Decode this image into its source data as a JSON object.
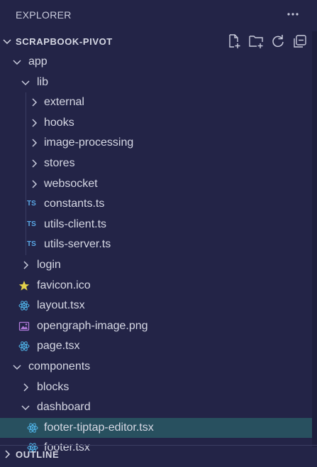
{
  "explorer": {
    "title": "EXPLORER",
    "more_icon": "ellipsis-icon"
  },
  "workspace": {
    "name": "SCRAPBOOK-PIVOT",
    "toolbar": [
      "new-file-icon",
      "new-folder-icon",
      "refresh-icon",
      "collapse-all-icon"
    ]
  },
  "tree": [
    {
      "label": "app",
      "kind": "folder",
      "expanded": true,
      "depth": 0
    },
    {
      "label": "lib",
      "kind": "folder",
      "expanded": true,
      "depth": 1
    },
    {
      "label": "external",
      "kind": "folder",
      "expanded": false,
      "depth": 2
    },
    {
      "label": "hooks",
      "kind": "folder",
      "expanded": false,
      "depth": 2
    },
    {
      "label": "image-processing",
      "kind": "folder",
      "expanded": false,
      "depth": 2
    },
    {
      "label": "stores",
      "kind": "folder",
      "expanded": false,
      "depth": 2
    },
    {
      "label": "websocket",
      "kind": "folder",
      "expanded": false,
      "depth": 2
    },
    {
      "label": "constants.ts",
      "kind": "ts",
      "depth": 2,
      "icon_text": "TS"
    },
    {
      "label": "utils-client.ts",
      "kind": "ts",
      "depth": 2,
      "icon_text": "TS"
    },
    {
      "label": "utils-server.ts",
      "kind": "ts",
      "depth": 2,
      "icon_text": "TS"
    },
    {
      "label": "login",
      "kind": "folder",
      "expanded": false,
      "depth": 1
    },
    {
      "label": "favicon.ico",
      "kind": "star",
      "depth": 1
    },
    {
      "label": "layout.tsx",
      "kind": "react",
      "depth": 1
    },
    {
      "label": "opengraph-image.png",
      "kind": "image",
      "depth": 1
    },
    {
      "label": "page.tsx",
      "kind": "react",
      "depth": 1
    },
    {
      "label": "components",
      "kind": "folder",
      "expanded": true,
      "depth": 0
    },
    {
      "label": "blocks",
      "kind": "folder",
      "expanded": false,
      "depth": 1
    },
    {
      "label": "dashboard",
      "kind": "folder",
      "expanded": true,
      "depth": 1
    },
    {
      "label": "footer-tiptap-editor.tsx",
      "kind": "react",
      "depth": 2,
      "selected": true
    },
    {
      "label": "footer.tsx",
      "kind": "react",
      "depth": 2
    }
  ],
  "outline": {
    "label": "OUTLINE",
    "expanded": false
  },
  "colors": {
    "background": "#232447",
    "selected_row": "#28505f",
    "ts_icon": "#5aa8e6",
    "react_icon": "#4fb3e8",
    "star_icon": "#e2d04a",
    "image_icon": "#b07ad9"
  }
}
